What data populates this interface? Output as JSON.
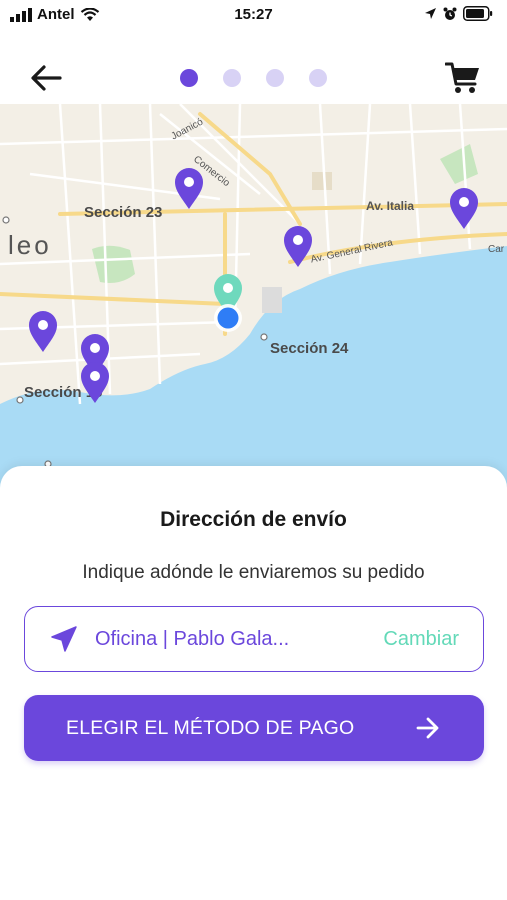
{
  "status_bar": {
    "carrier": "Antel",
    "time": "15:27"
  },
  "header": {
    "back_icon": "arrow-left-icon",
    "steps_total": 4,
    "step_current": 1,
    "cart_icon": "shopping-cart-icon"
  },
  "map": {
    "labels": {
      "seccion_23": "Sección 23",
      "seccion_24": "Sección 24",
      "seccion_15": "Sección 15",
      "city_fragment": "leo"
    },
    "streets": {
      "joanico": "Joanicó",
      "comercio": "Comercio",
      "av_italia": "Av. Italia",
      "av_general_rivera": "Av. General Rivera",
      "car_fragment": "Car"
    },
    "colors": {
      "pin": "#6b47dc",
      "selected_pin": "#6fd9bd",
      "user_location": "#2f7df6",
      "water": "#a9dbf5",
      "park": "#c7e6bf",
      "land": "#f3efe6"
    }
  },
  "sheet": {
    "title": "Dirección de envío",
    "subtitle": "Indique adónde le enviaremos su pedido",
    "address": {
      "icon": "location-arrow-icon",
      "text": "Oficina | Pablo Gala...",
      "change_label": "Cambiar"
    },
    "pay_button": {
      "label": "ELEGIR EL MÉTODO DE PAGO",
      "icon": "arrow-right-icon"
    }
  },
  "colors": {
    "accent": "#6b47dc",
    "accent_light": "#d8d2f5",
    "change_link": "#63d9b8"
  }
}
